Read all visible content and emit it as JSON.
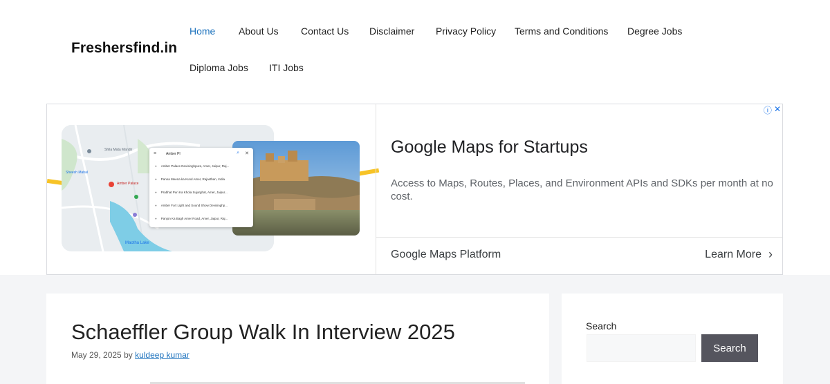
{
  "site": {
    "title": "Freshersfind.in"
  },
  "nav": [
    {
      "label": "Home",
      "active": true
    },
    {
      "label": "About Us"
    },
    {
      "label": "Contact Us"
    },
    {
      "label": "Disclaimer"
    },
    {
      "label": "Privacy Policy"
    },
    {
      "label": "Terms and Conditions"
    },
    {
      "label": "Degree Jobs"
    },
    {
      "label": "Diploma Jobs"
    },
    {
      "label": "ITI Jobs"
    }
  ],
  "ad": {
    "headline": "Google Maps for Startups",
    "description": "Access to Maps, Routes, Places, and Environment APIs and SDKs per month at no cost.",
    "brand": "Google Maps Platform",
    "cta": "Learn More",
    "cta_icon": "chevron-right-icon",
    "info_icon": "ⓘ",
    "close_icon": "✕",
    "map": {
      "search_value": "Amber Pl",
      "results": [
        "Amber Palace Devisinghpura, Amer, Jaipur, Raj...",
        "Panna Meena ka Kund Amer, Rajasthan, India",
        "Prabhat Puri Ka Khola Sujarghat, Amer, Jaipur...",
        "Amber Fort Light and Sound Show Devisinghp...",
        "Panjon Ka Bagh Amer Road, Amer, Jaipur, Raj..."
      ],
      "labels": {
        "temple": "Shila Mata Mandir",
        "sheesh": "Sheesh Mahal",
        "pin": "Amber Palace",
        "lake": "Maotha Lake"
      }
    },
    "accent_color": "#f7c326",
    "link_color": "#1a73e8"
  },
  "article": {
    "title": "Schaeffler Group Walk In Interview 2025",
    "date": "May 29, 2025",
    "by": "by",
    "author": "kuldeep kumar"
  },
  "sidebar": {
    "search_label": "Search",
    "search_value": "",
    "search_button": "Search"
  },
  "colors": {
    "nav_active": "#1e73be",
    "page_bg": "#f4f5f7",
    "search_button_bg": "#55555e"
  }
}
